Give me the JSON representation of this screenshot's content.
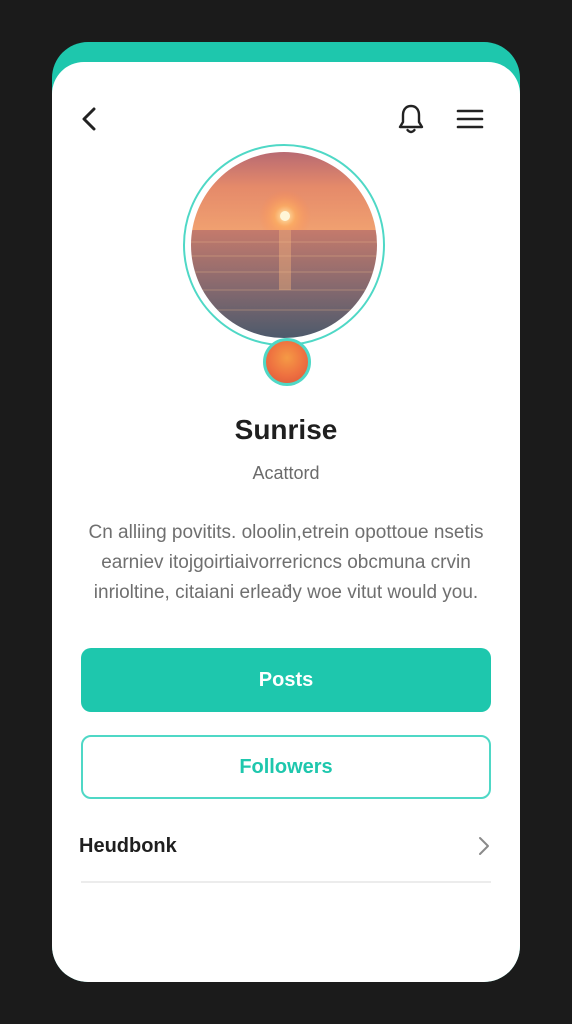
{
  "header": {
    "back_icon": "chevron-left-icon",
    "notifications_icon": "bell-icon",
    "menu_icon": "hamburger-menu-icon"
  },
  "profile": {
    "name": "Sunrise",
    "handle": "Acattord",
    "bio": "Cn alliing povitits. oloolin,etrein opottoue nsetis earniev itojgoirtiaivorrericncs obcmuna crvin inrioltine, citaiani erlead̈y woe vitut would you.",
    "avatar_image": "sunset-over-sea"
  },
  "actions": {
    "posts_label": "Posts",
    "followers_label": "Followers"
  },
  "list": {
    "items": [
      {
        "label": "Heudbonk",
        "chevron_icon": "chevron-right-icon"
      }
    ]
  },
  "colors": {
    "accent": "#1ec7ad",
    "accent_light": "#4fd8c6",
    "background": "#1b1b1b",
    "card": "#ffffff",
    "text_primary": "#1f1f1f",
    "text_secondary": "#6f6f6f"
  }
}
